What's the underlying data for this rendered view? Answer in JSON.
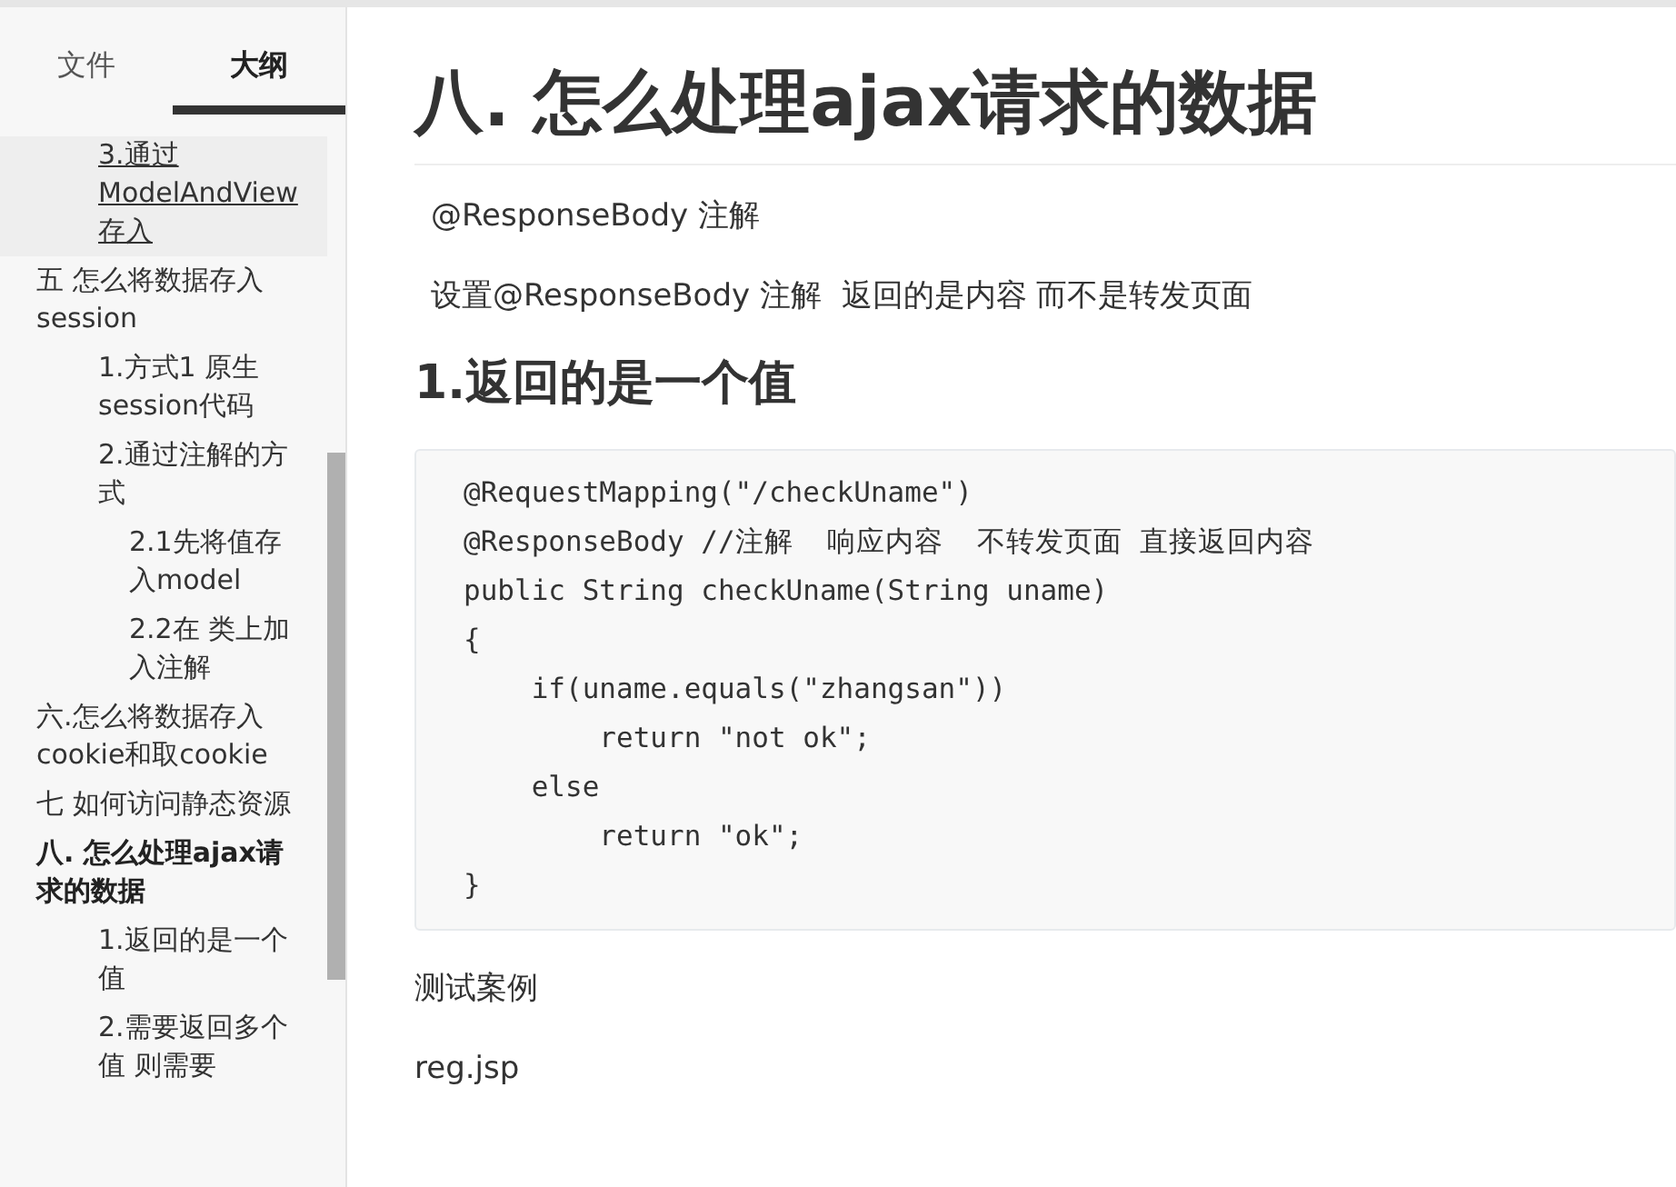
{
  "sidebar": {
    "tabs": [
      {
        "label": "文件",
        "selected": false
      },
      {
        "label": "大纲",
        "selected": true
      }
    ],
    "outline": [
      {
        "children": [
          {
            "label": "3.通过ModelAndView存入",
            "selected": false,
            "hovered": true
          }
        ]
      },
      {
        "label": "五 怎么将数据存入session",
        "selected": false,
        "hovered": false,
        "children": [
          {
            "label": "1.方式1 原生session代码",
            "selected": false,
            "hovered": false
          },
          {
            "label": "2.通过注解的方式",
            "selected": false,
            "hovered": false,
            "children": [
              {
                "label": "2.1先将值存入model",
                "selected": false,
                "hovered": false
              },
              {
                "label": "2.2在 类上加入注解",
                "selected": false,
                "hovered": false
              }
            ]
          }
        ]
      },
      {
        "label": "六.怎么将数据存入cookie和取cookie",
        "selected": false,
        "hovered": false
      },
      {
        "label": "七 如何访问静态资源",
        "selected": false,
        "hovered": false
      },
      {
        "label": "八. 怎么处理ajax请求的数据",
        "selected": true,
        "hovered": false,
        "children": [
          {
            "label": "1.返回的是一个值",
            "selected": false,
            "hovered": false
          },
          {
            "label": "2.需要返回多个值 则需要",
            "selected": false,
            "hovered": false
          }
        ]
      }
    ]
  },
  "document": {
    "blocks": [
      {
        "kind": "h1",
        "text": "八.  怎么处理ajax请求的数据"
      },
      {
        "kind": "indented",
        "text": "@ResponseBody 注解"
      },
      {
        "kind": "indented",
        "text": "设置@ResponseBody 注解  返回的是内容 而不是转发页面"
      },
      {
        "kind": "h2",
        "text": "1.返回的是一个值"
      },
      {
        "kind": "code",
        "lines": [
          "@RequestMapping(\"/checkUname\")",
          "@ResponseBody //注解  响应内容  不转发页面 直接返回内容",
          "public String checkUname(String uname)",
          "{",
          "    if(uname.equals(\"zhangsan\"))",
          "        return \"not ok\";",
          "    else",
          "        return \"ok\";",
          "}"
        ]
      },
      {
        "kind": "p",
        "text": "测试案例"
      },
      {
        "kind": "p",
        "text": "reg.jsp"
      }
    ]
  }
}
